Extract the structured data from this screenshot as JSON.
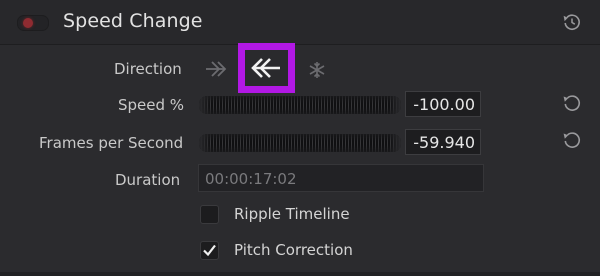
{
  "panel": {
    "title": "Speed Change",
    "enabled_color": "#8f2b31",
    "highlight_color": "#b218e5"
  },
  "direction": {
    "label": "Direction",
    "options": [
      {
        "icon": "forward-double-arrow-icon",
        "selected": false
      },
      {
        "icon": "reverse-double-arrow-icon",
        "selected": true
      },
      {
        "icon": "freeze-frame-snowflake-icon",
        "selected": false
      }
    ]
  },
  "speed": {
    "label": "Speed %",
    "value": "-100.00"
  },
  "fps": {
    "label": "Frames per Second",
    "value": "-59.940"
  },
  "duration": {
    "label": "Duration",
    "value": "00:00:17:02"
  },
  "ripple": {
    "label": "Ripple Timeline",
    "checked": false
  },
  "pitch": {
    "label": "Pitch Correction",
    "checked": true
  }
}
